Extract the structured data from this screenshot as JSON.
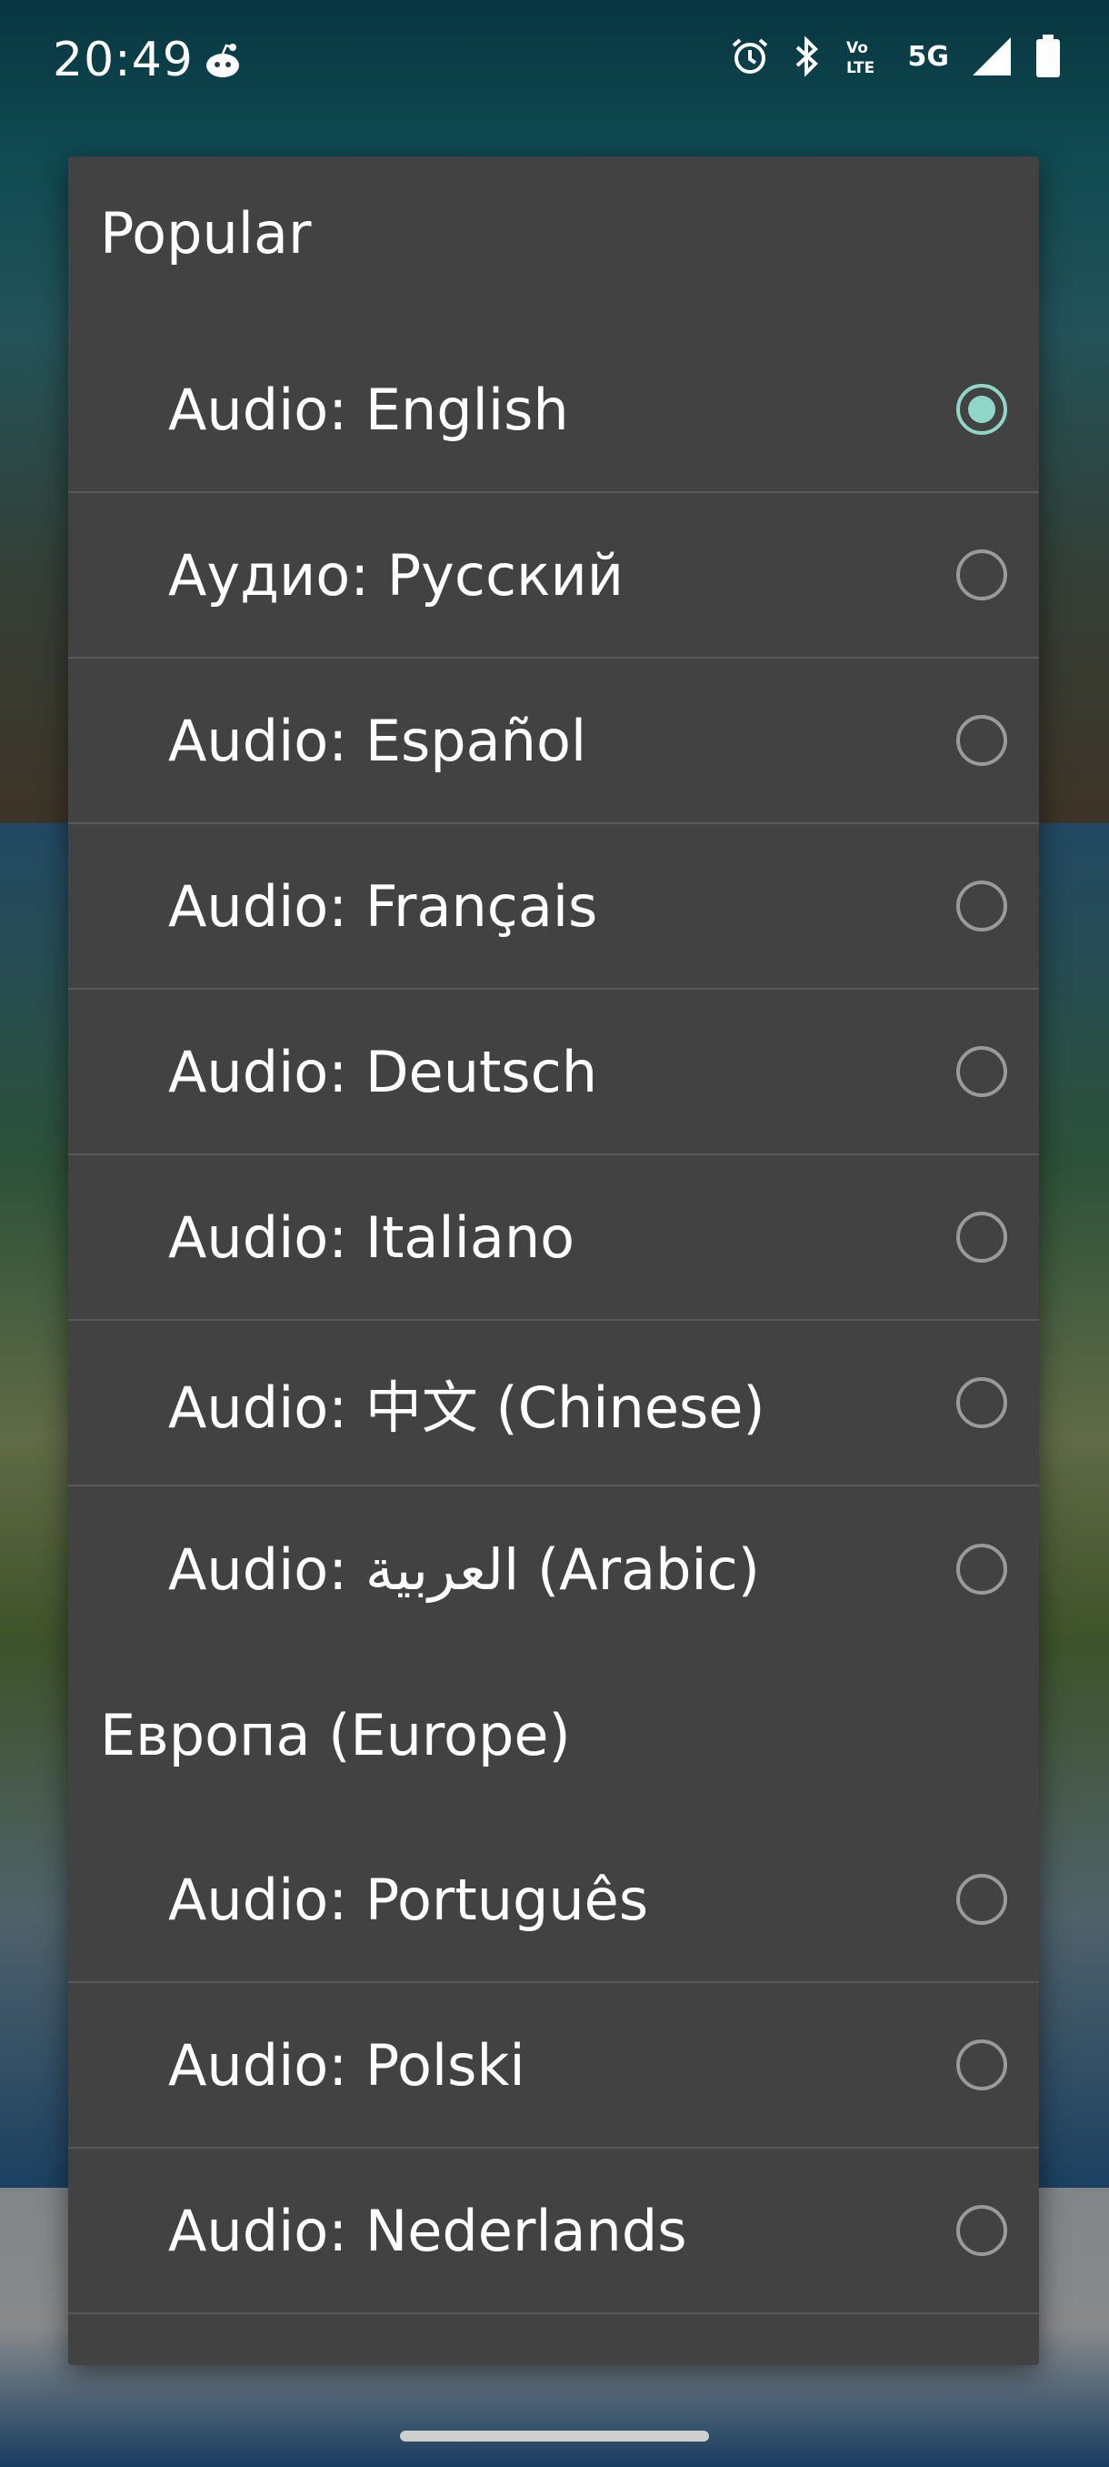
{
  "status_bar": {
    "time": "20:49",
    "network": "5G",
    "icons": [
      "reddit-icon",
      "alarm-icon",
      "bluetooth-icon",
      "volte-icon",
      "signal-icon",
      "battery-icon"
    ]
  },
  "dialog": {
    "sections": [
      {
        "title": "Popular",
        "options": [
          {
            "label": "Audio: English",
            "selected": true
          },
          {
            "label": "Аудио: Русский",
            "selected": false
          },
          {
            "label": "Audio: Español",
            "selected": false
          },
          {
            "label": "Audio: Français",
            "selected": false
          },
          {
            "label": "Audio: Deutsch",
            "selected": false
          },
          {
            "label": "Audio: Italiano",
            "selected": false
          },
          {
            "label": "Audio: 中文 (Chinese)",
            "selected": false
          },
          {
            "label": "Audio: العربية (Arabic)",
            "selected": false
          }
        ]
      },
      {
        "title": "Европа (Europe)",
        "options": [
          {
            "label": "Audio: Português",
            "selected": false
          },
          {
            "label": "Audio: Polski",
            "selected": false
          },
          {
            "label": "Audio: Nederlands",
            "selected": false
          }
        ]
      }
    ]
  },
  "colors": {
    "accent": "#8fd6c7",
    "dialog_bg": "#424242",
    "divider": "#5a5a5a",
    "radio_off": "#9a9a9a"
  }
}
